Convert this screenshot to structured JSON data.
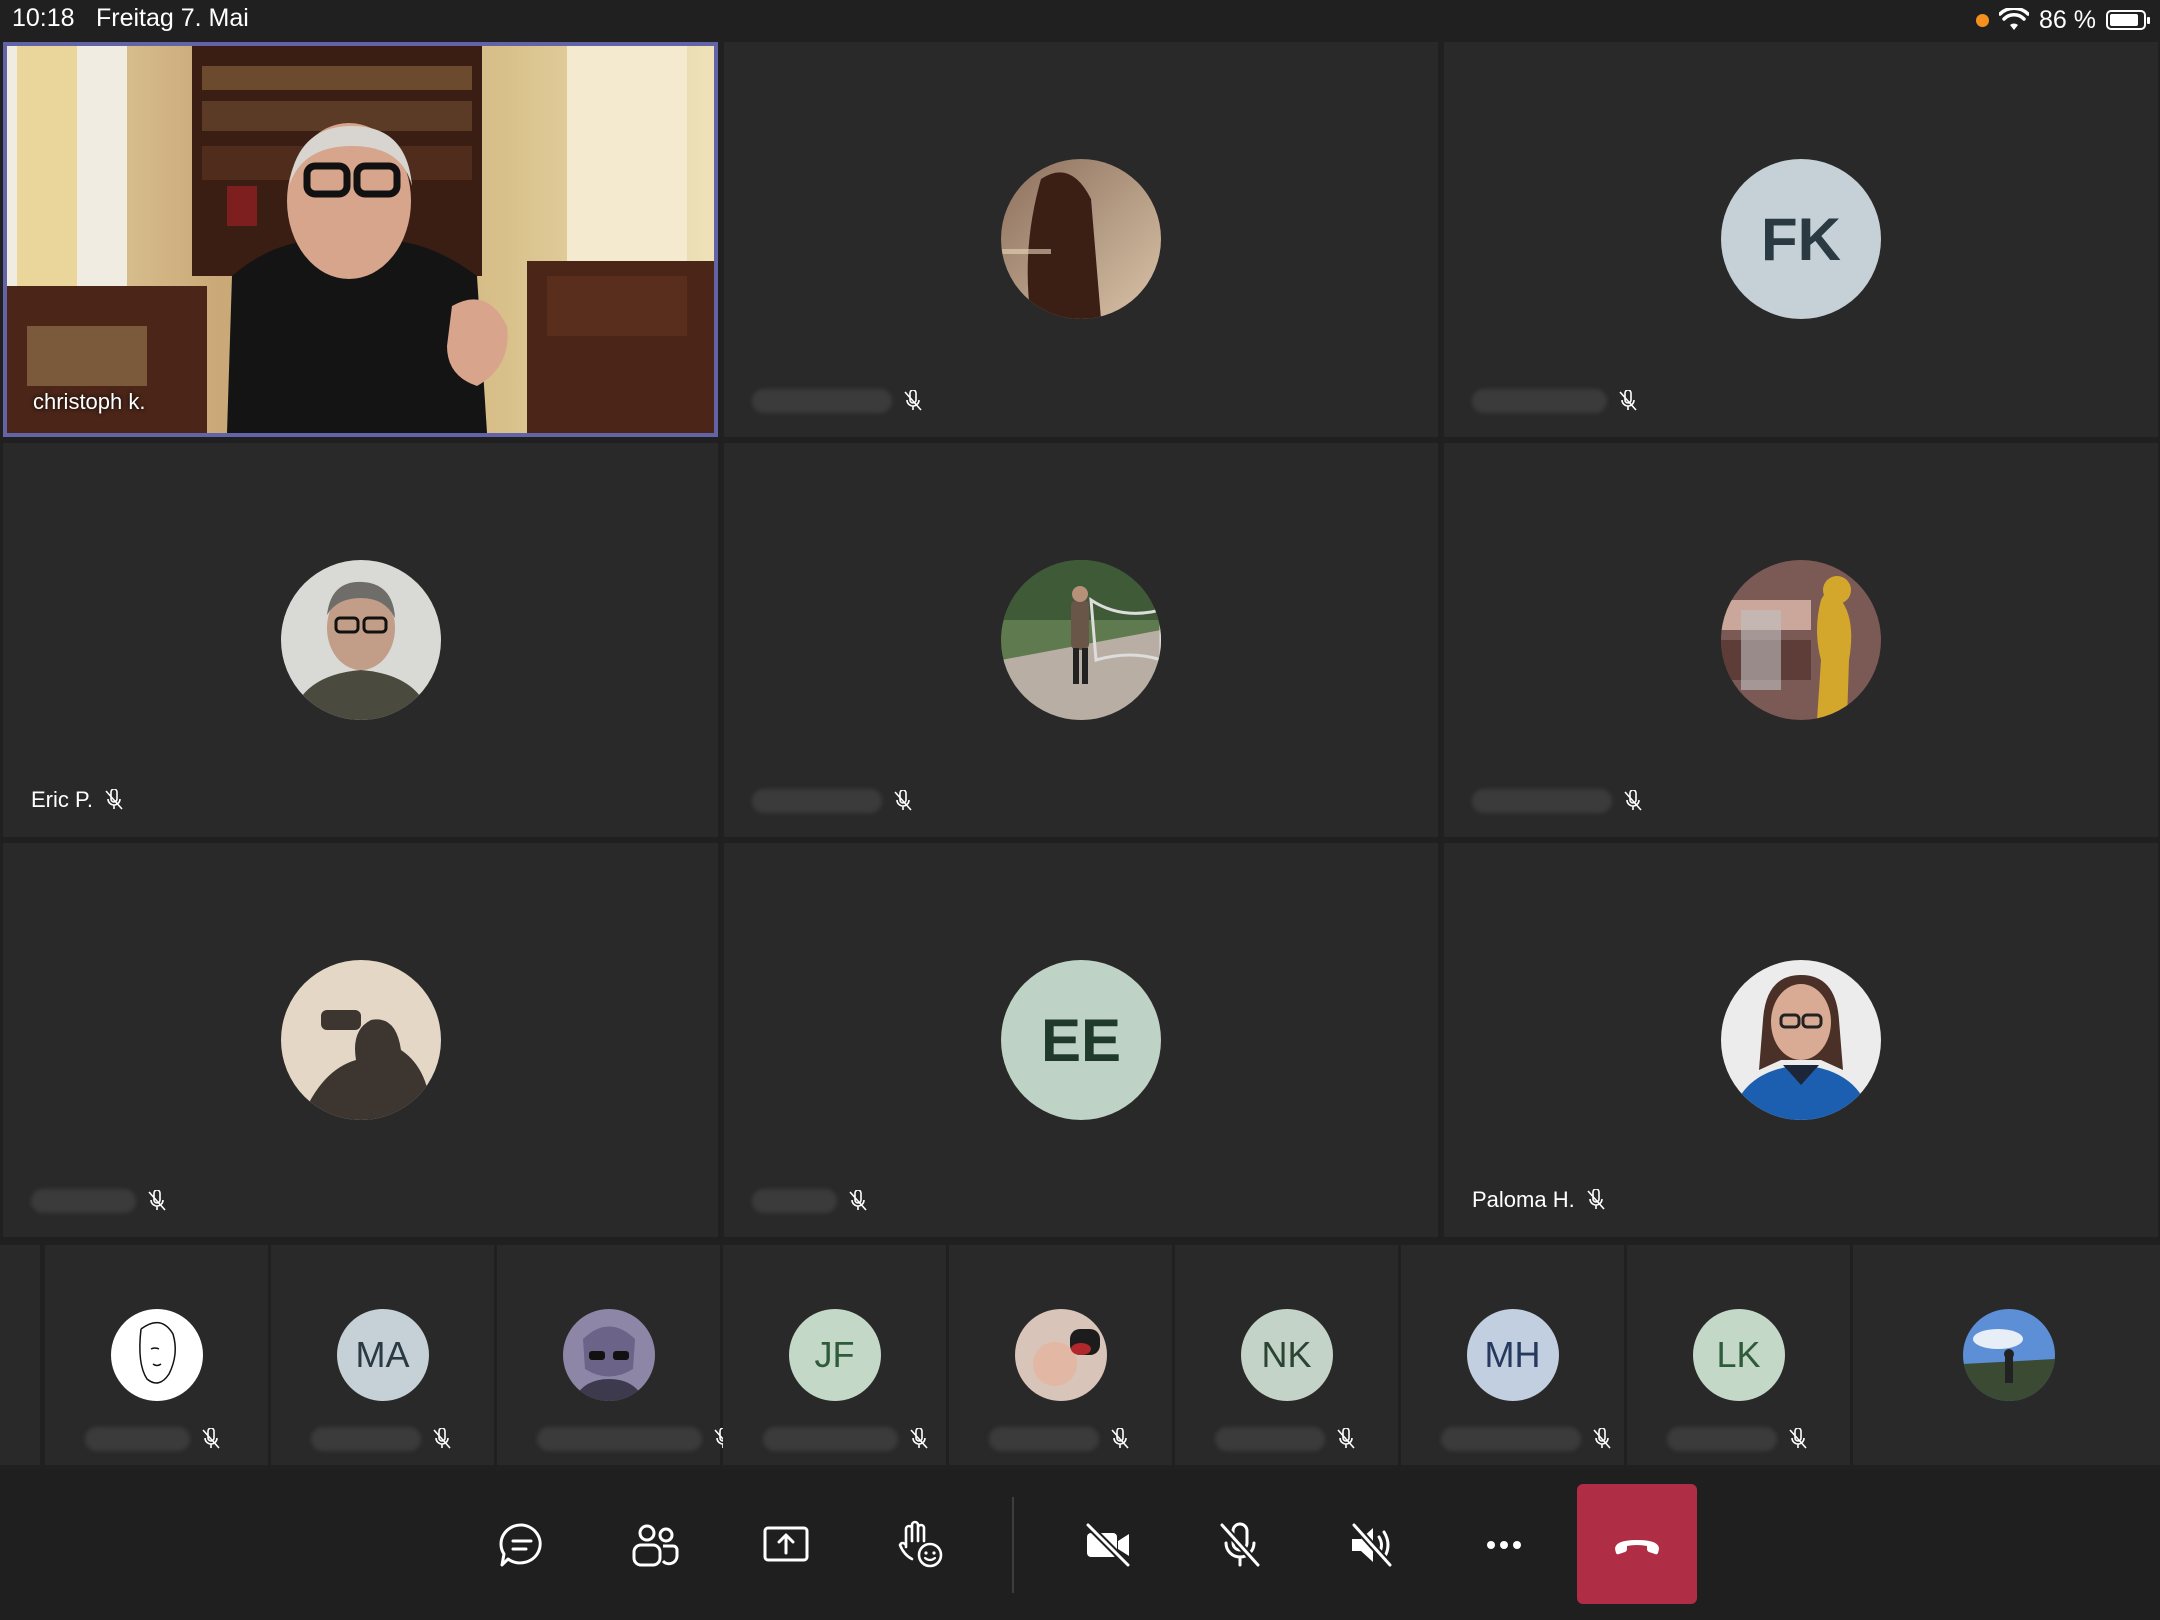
{
  "status_bar": {
    "time": "10:18",
    "date": "Freitag 7. Mai",
    "battery": "86 %"
  },
  "video_tile": {
    "name": "christoph k."
  },
  "grid": {
    "tile_2": {
      "muted": true
    },
    "tile_3": {
      "initials": "FK",
      "muted": true
    },
    "tile_4": {
      "name": "Eric P.",
      "muted": true
    },
    "tile_5": {
      "muted": true
    },
    "tile_6": {
      "muted": true
    },
    "tile_7": {
      "muted": true
    },
    "tile_8": {
      "initials": "EE",
      "muted": true
    },
    "tile_9": {
      "name": "Paloma H.",
      "muted": true
    }
  },
  "strip": {
    "initials_ma": "MA",
    "initials_jf": "JF",
    "initials_nk": "NK",
    "initials_mh": "MH",
    "initials_lk": "LK"
  },
  "controls": [
    {
      "icon": "chat-icon"
    },
    {
      "icon": "participants-icon"
    },
    {
      "icon": "share-screen-icon"
    },
    {
      "icon": "reactions-icon"
    },
    {
      "icon": "camera-off-icon"
    },
    {
      "icon": "mic-off-icon"
    },
    {
      "icon": "speaker-off-icon"
    },
    {
      "icon": "more-icon"
    },
    {
      "icon": "hang-up-icon"
    }
  ],
  "colors": {
    "accent": "#6264a7",
    "hangup": "#b02e45",
    "background": "#202020",
    "tile": "#292929"
  }
}
